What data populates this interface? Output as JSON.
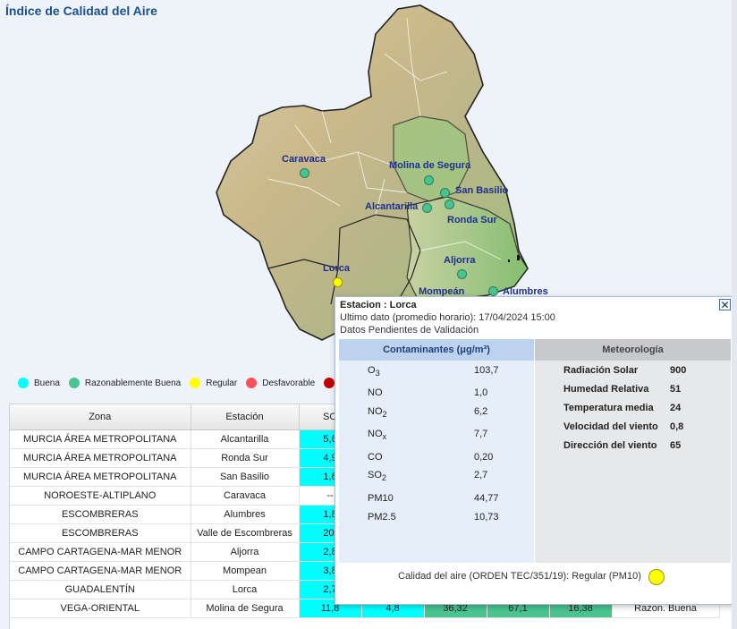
{
  "title": "Índice de Calidad del Aire",
  "legend": [
    {
      "label": "Buena",
      "color": "#00ffff"
    },
    {
      "label": "Razonablemente Buena",
      "color": "#49c48f"
    },
    {
      "label": "Regular",
      "color": "#ffff00"
    },
    {
      "label": "Desfavorable",
      "color": "#ff4d5a"
    },
    {
      "label": "",
      "color": "#c00000"
    }
  ],
  "map": {
    "stations": [
      {
        "name": "Caravaca",
        "color": "#49c48f"
      },
      {
        "name": "Molina de Segura",
        "color": "#49c48f"
      },
      {
        "name": "San Basilio",
        "color": "#49c48f"
      },
      {
        "name": "Alcantarilla",
        "color": "#49c48f"
      },
      {
        "name": "Ronda Sur",
        "color": "#49c48f"
      },
      {
        "name": "Aljorra",
        "color": "#49c48f"
      },
      {
        "name": "Lorca",
        "color": "#ffff00"
      },
      {
        "name": "Mompeán",
        "color": "#49c48f"
      },
      {
        "name": "Alumbres",
        "color": "#49c48f"
      }
    ]
  },
  "table": {
    "headers": [
      "Zona",
      "Estación",
      "SO"
    ],
    "rows": [
      {
        "zona": "MURCIA ÁREA METROPOLITANA",
        "estacion": "Alcantarilla",
        "so2": "5,6"
      },
      {
        "zona": "MURCIA ÁREA METROPOLITANA",
        "estacion": "Ronda Sur",
        "so2": "4,9"
      },
      {
        "zona": "MURCIA ÁREA METROPOLITANA",
        "estacion": "San Basilio",
        "so2": "1,6"
      },
      {
        "zona": "NOROESTE-ALTIPLANO",
        "estacion": "Caravaca",
        "so2": "--"
      },
      {
        "zona": "ESCOMBRERAS",
        "estacion": "Alumbres",
        "so2": "1,8"
      },
      {
        "zona": "ESCOMBRERAS",
        "estacion": "Valle de Escombreras",
        "so2": "20,"
      },
      {
        "zona": "CAMPO CARTAGENA-MAR MENOR",
        "estacion": "Aljorra",
        "so2": "2,8"
      },
      {
        "zona": "CAMPO CARTAGENA-MAR MENOR",
        "estacion": "Mompean",
        "so2": "3,8"
      },
      {
        "zona": "GUADALENTÍN",
        "estacion": "Lorca",
        "so2": "2,7"
      },
      {
        "zona": "VEGA-ORIENTAL",
        "estacion": "Molina de Segura",
        "so2": "11,8",
        "c2": "4,8",
        "c3": "36,32",
        "c4": "67,1",
        "c5": "16,38",
        "c6": "Razon. Buena"
      }
    ]
  },
  "popup": {
    "station": "Estacion : Lorca",
    "last_data": "Ultimo dato (promedio horario): 17/04/2024 15:00",
    "validation": "Datos Pendientes de Validación",
    "close": "✕",
    "pollutants_header": "Contaminantes (μg/m³)",
    "meteo_header": "Meteorología",
    "pollutants": [
      {
        "name": "O",
        "sub": "3",
        "value": "103,7"
      },
      {
        "name": "NO",
        "sub": "",
        "value": "1,0"
      },
      {
        "name": "NO",
        "sub": "2",
        "value": "6,2"
      },
      {
        "name": "NO",
        "sub": "x",
        "value": "7,7"
      },
      {
        "name": "CO",
        "sub": "",
        "value": "0,20"
      },
      {
        "name": "SO",
        "sub": "2",
        "value": "2,7"
      },
      {
        "name": "PM10",
        "sub": "",
        "value": "44,77"
      },
      {
        "name": "PM2.5",
        "sub": "",
        "value": "10,73"
      }
    ],
    "meteo": [
      {
        "name": "Radiación Solar",
        "value": "900"
      },
      {
        "name": "Humedad Relativa",
        "value": "51"
      },
      {
        "name": "Temperatura media",
        "value": "24"
      },
      {
        "name": "Velocidad del viento",
        "value": "0,8"
      },
      {
        "name": "Dirección del viento",
        "value": "65"
      }
    ],
    "footer": "Calidad del aire (ORDEN TEC/351/19): Regular (PM10)",
    "aqi_color": "#ffff00"
  }
}
